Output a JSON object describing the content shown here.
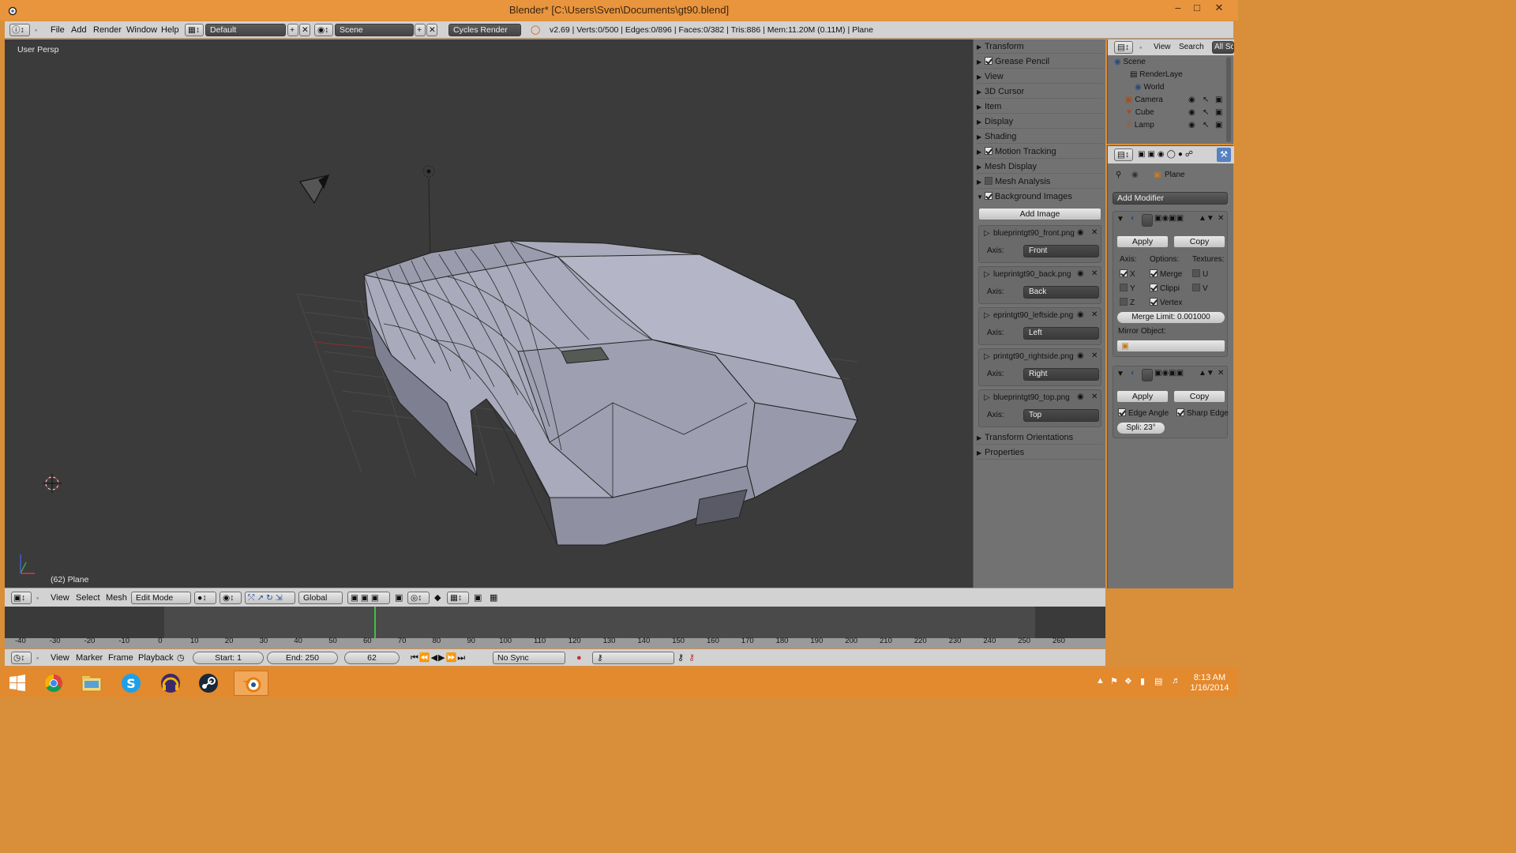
{
  "window": {
    "title": "Blender* [C:\\Users\\Sven\\Documents\\gt90.blend]"
  },
  "colors": {
    "accent": "#e8953e",
    "viewport_bg": "#3b3b3b",
    "mesh": "#a9aabb",
    "panel": "#727272",
    "frame_marker": "#3ec23e"
  },
  "info_header": {
    "menus": [
      "File",
      "Add",
      "Render",
      "Window",
      "Help"
    ],
    "layout": "Default",
    "scene": "Scene",
    "engine": "Cycles Render",
    "status": "v2.69 | Verts:0/500 | Edges:0/896 | Faces:0/382 | Tris:886 | Mem:11.20M (0.11M) | Plane"
  },
  "viewport": {
    "view_label": "User Persp",
    "object_label": "(62) Plane"
  },
  "view3d_header": {
    "menus": [
      "View",
      "Select",
      "Mesh"
    ],
    "mode": "Edit Mode",
    "orientation": "Global"
  },
  "npanel": {
    "sections": [
      {
        "label": "Transform",
        "checkbox": false
      },
      {
        "label": "Grease Pencil",
        "checkbox": true
      },
      {
        "label": "View",
        "checkbox": false
      },
      {
        "label": "3D Cursor",
        "checkbox": false
      },
      {
        "label": "Item",
        "checkbox": false
      },
      {
        "label": "Display",
        "checkbox": false
      },
      {
        "label": "Shading",
        "checkbox": false
      },
      {
        "label": "Motion Tracking",
        "checkbox": true
      },
      {
        "label": "Mesh Display",
        "checkbox": false
      },
      {
        "label": "Mesh Analysis",
        "checkbox": true
      },
      {
        "label": "Background Images",
        "checkbox": true
      }
    ],
    "add_image": "Add Image",
    "axis_label": "Axis:",
    "bg_images": [
      {
        "name": "blueprintgt90_front.png",
        "axis": "Front"
      },
      {
        "name": "lueprintgt90_back.png",
        "axis": "Back"
      },
      {
        "name": "eprintgt90_leftside.png",
        "axis": "Left"
      },
      {
        "name": "printgt90_rightside.png",
        "axis": "Right"
      },
      {
        "name": "blueprintgt90_top.png",
        "axis": "Top"
      }
    ],
    "after": [
      "Transform Orientations",
      "Properties"
    ]
  },
  "outliner": {
    "menus": [
      "View",
      "Search",
      "All Sc"
    ],
    "items": [
      "Scene",
      "RenderLaye",
      "World",
      "Camera",
      "Cube",
      "Lamp"
    ]
  },
  "properties": {
    "object": "Plane",
    "add_modifier": "Add Modifier",
    "apply": "Apply",
    "copy": "Copy",
    "mirror": {
      "axis_label": "Axis:",
      "options_label": "Options:",
      "textures_label": "Textures:",
      "x": "X",
      "y": "Y",
      "z": "Z",
      "merge": "Merge",
      "clipping": "Clippi",
      "vertex": "Vertex",
      "u": "U",
      "v": "V",
      "merge_limit": "Merge Limit: 0.001000",
      "mirror_object": "Mirror Object:"
    },
    "edge_split": {
      "edge_angle": "Edge Angle",
      "sharp_edge": "Sharp Edge",
      "split_angle": "Spli: 23°"
    }
  },
  "timeline": {
    "ticks": [
      "-40",
      "-30",
      "-20",
      "-10",
      "0",
      "10",
      "20",
      "30",
      "40",
      "50",
      "60",
      "70",
      "80",
      "90",
      "100",
      "110",
      "120",
      "130",
      "140",
      "150",
      "160",
      "170",
      "180",
      "190",
      "200",
      "210",
      "220",
      "230",
      "240",
      "250",
      "260"
    ],
    "current_frame": 62,
    "menus": [
      "View",
      "Marker",
      "Frame",
      "Playback"
    ],
    "start": "Start: 1",
    "end": "End: 250",
    "frame": "62",
    "sync": "No Sync"
  },
  "taskbar": {
    "apps": [
      "start-icon",
      "chrome-icon",
      "file-explorer-icon",
      "skype-icon",
      "headphones-icon",
      "steam-icon",
      "blender-icon"
    ],
    "time": "8:13 AM",
    "date": "1/16/2014"
  }
}
